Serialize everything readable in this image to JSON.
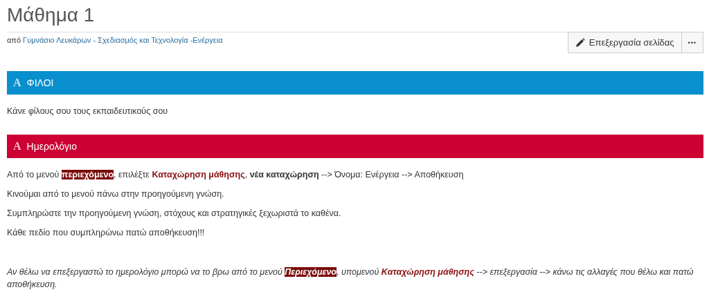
{
  "page": {
    "title": "Μάθημα 1",
    "byline_prefix": "από",
    "byline_link": "Γυμνάσιο Λευκάρων - Σχεδιασμός και Τεχνολογία -Ενέργεια"
  },
  "toolbar": {
    "edit_button": "Επεξεργασία σελίδας",
    "more_button": "•••"
  },
  "sections": [
    {
      "icon": "A",
      "heading": "ΦΙΛΟΙ",
      "color": "#0a8fce",
      "paragraphs": [
        {
          "kind": "text",
          "segments": [
            {
              "kind": "plain",
              "text": "Κάνε φίλους σου τους εκπαιδευτικούς σου"
            }
          ]
        }
      ]
    },
    {
      "icon": "A",
      "heading": "Ημερολόγιο",
      "color": "#cc0033",
      "paragraphs": [
        {
          "kind": "text",
          "segments": [
            {
              "kind": "plain",
              "text": "Από το μενού "
            },
            {
              "kind": "highlight",
              "text": "περιεχόμενο"
            },
            {
              "kind": "plain",
              "text": ", επιλέξτε "
            },
            {
              "kind": "emphasis",
              "text": "Καταχώρηση μάθησης"
            },
            {
              "kind": "plain",
              "text": ", "
            },
            {
              "kind": "bold",
              "text": "νέα καταχώρηση"
            },
            {
              "kind": "plain",
              "text": " --> Όνομα: Ενέργεια --> Αποθήκευση"
            }
          ]
        },
        {
          "kind": "text",
          "segments": [
            {
              "kind": "plain",
              "text": "Κινούμαι από το μενού πάνω στην προηγούμενη γνώση."
            }
          ]
        },
        {
          "kind": "text",
          "segments": [
            {
              "kind": "plain",
              "text": "Συμπληρώστε την προηγούμενη γνώση, στόχους και στρατηγικές ξεχωριστά το καθένα."
            }
          ]
        },
        {
          "kind": "text",
          "segments": [
            {
              "kind": "plain",
              "text": "Κάθε πεδίο που συμπληρώνω πατώ αποθήκευση!!!"
            }
          ]
        },
        {
          "kind": "note",
          "segments": [
            {
              "kind": "plain",
              "text": "Αν θέλω να επεξεργαστώ το ημερολόγιο μπορώ να το βρω από το μενού "
            },
            {
              "kind": "highlight",
              "text": "Περιεχόμενο"
            },
            {
              "kind": "plain",
              "text": ", υπομενού "
            },
            {
              "kind": "emphasis",
              "text": "Καταχώρηση μάθησης"
            },
            {
              "kind": "plain",
              "text": " --> επεξεργασία  --> κάνω τις αλλαγές που θέλω και πατώ αποθήκευση."
            }
          ]
        }
      ]
    }
  ]
}
